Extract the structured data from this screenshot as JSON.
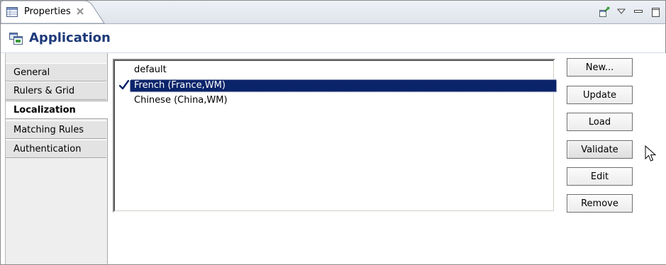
{
  "tab": {
    "title": "Properties",
    "icon": "properties-table-icon",
    "close_icon": "close-icon"
  },
  "toolbar_icons": [
    "pin-icon",
    "view-menu-icon",
    "minimize-icon",
    "maximize-icon"
  ],
  "header": {
    "title": "Application",
    "icon": "application-icon"
  },
  "sidebar": {
    "items": [
      {
        "label": "General"
      },
      {
        "label": "Rulers & Grid"
      },
      {
        "label": "Localization",
        "active": true
      },
      {
        "label": "Matching Rules"
      },
      {
        "label": "Authentication"
      }
    ]
  },
  "locales": {
    "items": [
      {
        "label": "default",
        "checked": false,
        "selected": false
      },
      {
        "label": "French (France,WM)",
        "checked": true,
        "selected": true
      },
      {
        "label": "Chinese (China,WM)",
        "checked": false,
        "selected": false
      }
    ]
  },
  "buttons": {
    "new": "New...",
    "update": "Update",
    "load": "Load",
    "validate": "Validate",
    "edit": "Edit",
    "remove": "Remove"
  },
  "colors": {
    "selection": "#0a246a",
    "header_title": "#1d3a79",
    "check": "#0a246a"
  }
}
